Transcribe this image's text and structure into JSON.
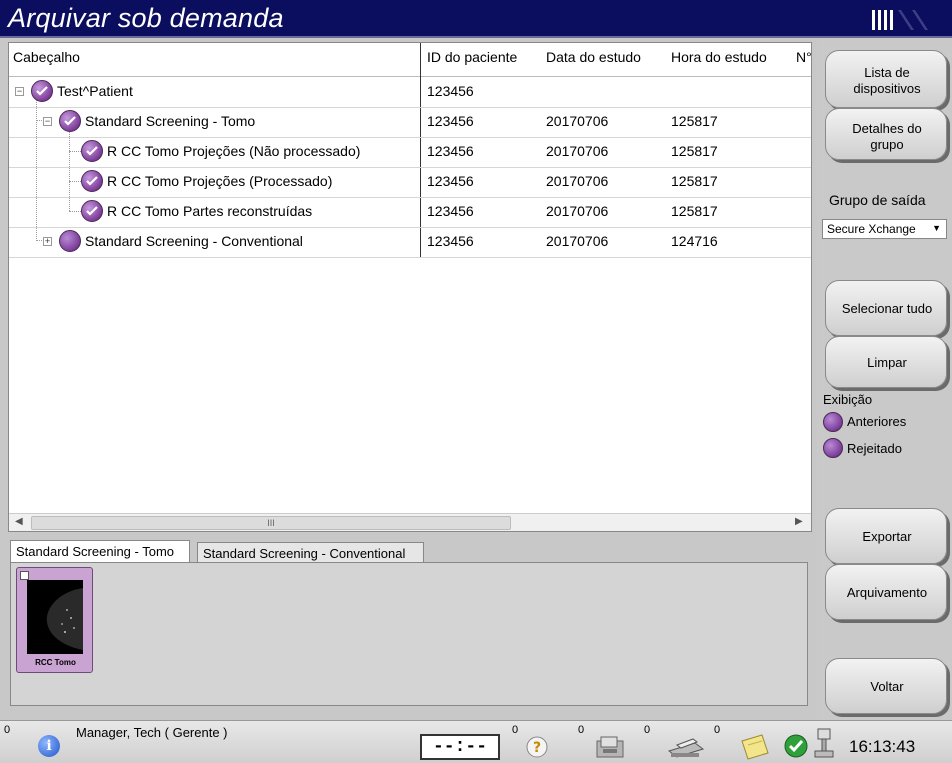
{
  "window": {
    "title": "Arquivar sob demanda"
  },
  "table": {
    "columns": [
      "Cabeçalho",
      "ID do paciente",
      "Data do estudo",
      "Hora do estudo",
      "N°"
    ],
    "rows": [
      {
        "label": "Test^Patient",
        "patient_id": "123456",
        "date": "",
        "time": ""
      },
      {
        "label": "Standard Screening - Tomo",
        "patient_id": "123456",
        "date": "20170706",
        "time": "125817"
      },
      {
        "label": "R CC Tomo  Projeções (Não processado)",
        "patient_id": "123456",
        "date": "20170706",
        "time": "125817"
      },
      {
        "label": "R CC Tomo  Projeções (Processado)",
        "patient_id": "123456",
        "date": "20170706",
        "time": "125817"
      },
      {
        "label": "R CC Tomo  Partes reconstruídas",
        "patient_id": "123456",
        "date": "20170706",
        "time": "125817"
      },
      {
        "label": "Standard Screening - Conventional",
        "patient_id": "123456",
        "date": "20170706",
        "time": "124716"
      }
    ],
    "scroll_thumb_glyph": "III"
  },
  "tabs": [
    {
      "label": "Standard Screening - Tomo",
      "active": true
    },
    {
      "label": "Standard Screening - Conventional",
      "active": false
    }
  ],
  "thumbnail": {
    "label": "RCC Tomo"
  },
  "side": {
    "device_list": [
      "Lista de",
      "dispositivos"
    ],
    "group_details": [
      "Detalhes do",
      "grupo"
    ],
    "output_group_label": "Grupo de saída",
    "output_group_value": "Secure Xchange",
    "select_all": "Selecionar tudo",
    "clear": "Limpar",
    "display_label": "Exibição",
    "previous": "Anteriores",
    "rejected": "Rejeitado",
    "export": "Exportar",
    "archive": "Arquivamento",
    "back": "Voltar"
  },
  "status": {
    "count_left": "0",
    "user": "Manager, Tech ( Gerente )",
    "timer": "--:--",
    "count_1": "0",
    "count_2": "0",
    "count_3": "0",
    "count_4": "0",
    "clock": "16:13:43"
  }
}
